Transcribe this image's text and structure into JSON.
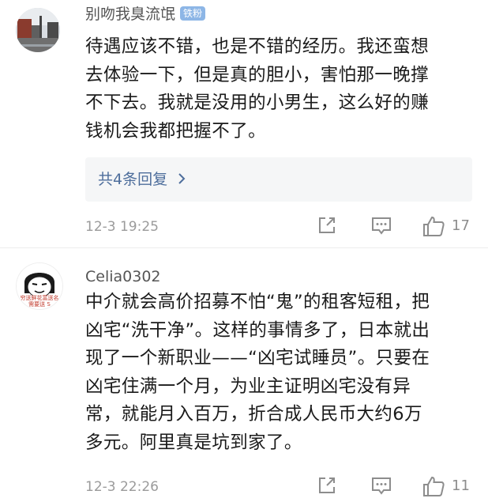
{
  "comments": [
    {
      "username": "别吻我臭流氓",
      "badge": "铁粉",
      "lines": [
        "待遇应该不错，也是不错的经历。我还蛮想",
        "去体验一下，但是真的胆小，害怕那一晚撑",
        "不下去。我就是没用的小男生，这么好的赚",
        "钱机会我都把握不了。"
      ],
      "replies_label": "共4条回复",
      "timestamp": "12-3 19:25",
      "likes": "17"
    },
    {
      "username": "Celia0302",
      "lines": [
        "中介就会高价招募不怕“鬼”的租客短租，把",
        "凶宅“洗干净”。这样的事情多了，日本就出",
        "现了一个新职业——“凶宅试睡员”。只要在",
        "凶宅住满一个月，为业主证明凶宅没有异",
        "常，就能月入百万，折合成人民币大约6万",
        "多元。阿里真是坑到家了。"
      ],
      "timestamp": "12-3 22:26",
      "likes": "11",
      "avatar_caption": "穷送鲜花富送名 需要送 S"
    }
  ],
  "icons": {
    "share": "share-icon",
    "comment": "comment-icon",
    "like": "thumbs-up-icon",
    "chevron": "chevron-right-icon"
  },
  "colors": {
    "link": "#4e6e9c",
    "badge": "#8db6e6",
    "meta": "#9b9b9b",
    "reply_bg": "#f5f6f7"
  }
}
